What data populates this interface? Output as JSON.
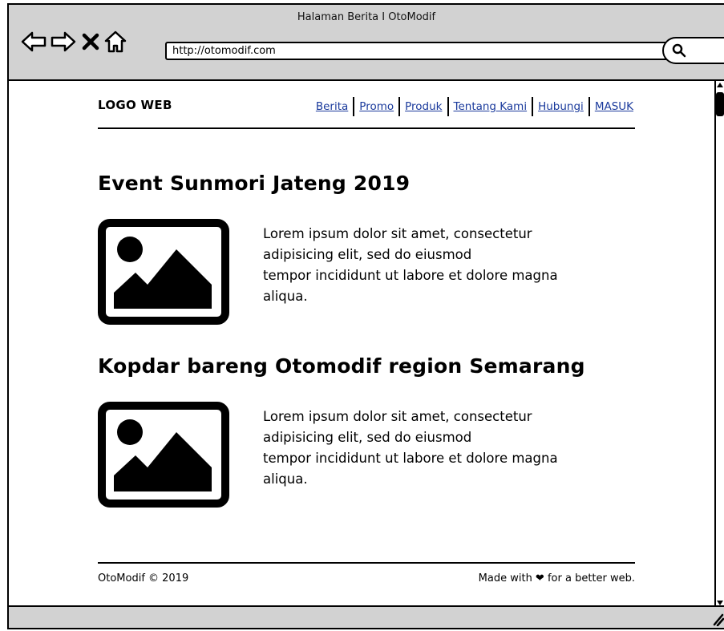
{
  "window": {
    "title": "Halaman Berita I OtoModif"
  },
  "address_bar": {
    "url": "http://otomodif.com"
  },
  "toolbar_icons": [
    "back-arrow-icon",
    "forward-arrow-icon",
    "close-icon",
    "home-icon",
    "search-icon"
  ],
  "site": {
    "logo": "LOGO WEB",
    "nav": [
      {
        "label": "Berita"
      },
      {
        "label": "Promo"
      },
      {
        "label": "Produk"
      },
      {
        "label": "Tentang Kami"
      },
      {
        "label": "Hubungi"
      },
      {
        "label": "MASUK"
      }
    ]
  },
  "articles": [
    {
      "title": "Event Sunmori Jateng 2019",
      "body": [
        "Lorem ipsum dolor sit amet, consectetur",
        "adipisicing elit, sed do eiusmod",
        "tempor incididunt ut labore et dolore magna",
        "aliqua."
      ]
    },
    {
      "title": "Kopdar bareng Otomodif region Semarang",
      "body": [
        "Lorem ipsum dolor sit amet, consectetur",
        "adipisicing elit, sed do eiusmod",
        "tempor incididunt ut labore et dolore magna",
        "aliqua."
      ]
    }
  ],
  "footer": {
    "copyright": "OtoModif © 2019",
    "credit": "Made with ❤ for a better web."
  }
}
